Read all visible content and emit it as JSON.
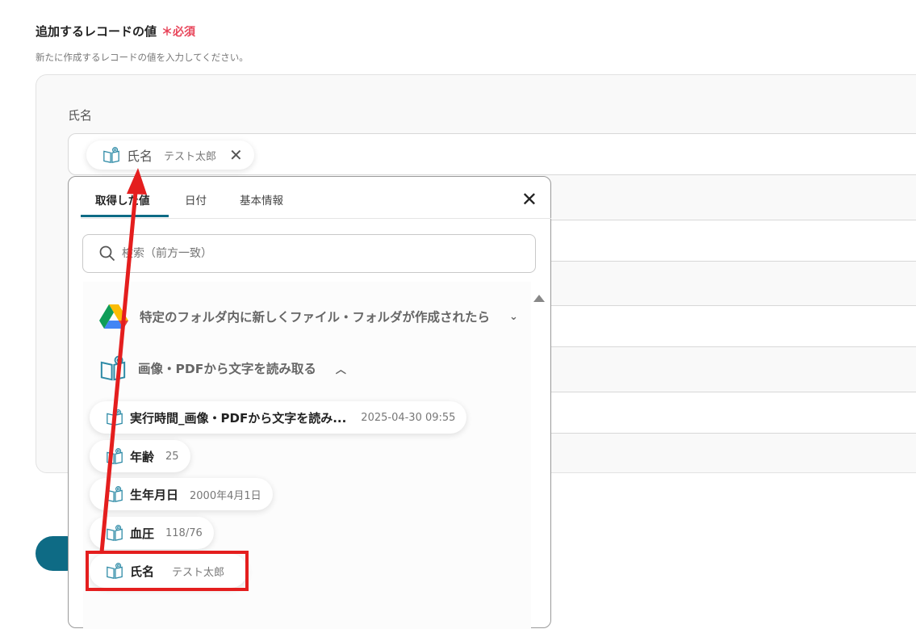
{
  "section": {
    "title": "追加するレコードの値",
    "required": "＊必須",
    "description": "新たに作成するレコードの値を入力してください。"
  },
  "field": {
    "label": "氏名",
    "chip_key": "氏名",
    "chip_value": "テスト太郎"
  },
  "dropdown": {
    "tabs": [
      "取得した値",
      "日付",
      "基本情報"
    ],
    "search_placeholder": "検索（前方一致）",
    "groups": [
      {
        "title": "特定のフォルダ内に新しくファイル・フォルダが作成されたら",
        "icon": "google-drive-icon",
        "expanded": false
      },
      {
        "title": "画像・PDFから文字を読み取る",
        "icon": "ocr-book-icon",
        "expanded": true
      }
    ],
    "items": [
      {
        "key": "実行時間_画像・PDFから文字を読み...",
        "value": "2025-04-30 09:55"
      },
      {
        "key": "年齢",
        "value": "25"
      },
      {
        "key": "生年月日",
        "value": "2000年4月1日"
      },
      {
        "key": "血圧",
        "value": "118/76"
      },
      {
        "key": "氏名",
        "value": "テスト太郎"
      }
    ]
  },
  "colors": {
    "accent": "#0e6b85",
    "annotation": "#e41e1e",
    "required": "#e8455a"
  }
}
